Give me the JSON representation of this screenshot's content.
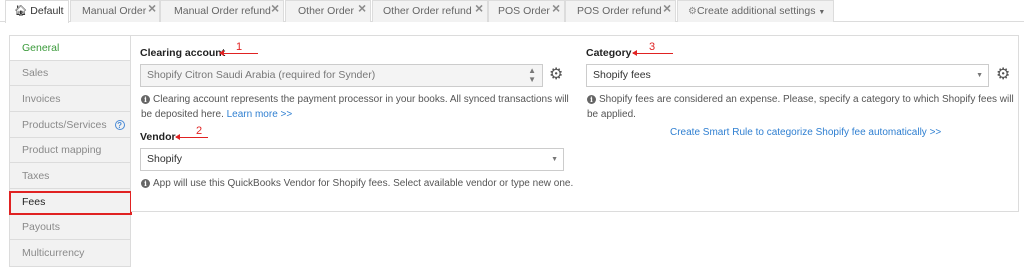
{
  "tabs": [
    {
      "label": "Default",
      "active": true,
      "icon": "home-icon",
      "closable": false
    },
    {
      "label": "Manual Order",
      "closable": true
    },
    {
      "label": "Manual Order refund",
      "closable": true
    },
    {
      "label": "Other Order",
      "closable": true
    },
    {
      "label": "Other Order refund",
      "closable": true
    },
    {
      "label": "POS Order",
      "closable": true
    },
    {
      "label": "POS Order refund",
      "closable": true
    },
    {
      "label": "Create additional settings",
      "icon": "gear-icon",
      "dropdown": true
    }
  ],
  "sidebar": {
    "items": [
      {
        "label": "General",
        "selected": true
      },
      {
        "label": "Sales"
      },
      {
        "label": "Invoices"
      },
      {
        "label": "Products/Services",
        "help_icon": true
      },
      {
        "label": "Product mapping"
      },
      {
        "label": "Taxes"
      },
      {
        "label": "Fees",
        "highlighted": true
      },
      {
        "label": "Payouts"
      },
      {
        "label": "Multicurrency"
      }
    ]
  },
  "clearing": {
    "label": "Clearing account",
    "marker": "1",
    "value": "Shopify Citron Saudi Arabia (required for Synder)",
    "help_text": "Clearing account represents the payment processor in your books. All synced transactions will be deposited here.",
    "learn_more": "Learn more >>"
  },
  "vendor": {
    "label": "Vendor",
    "marker": "2",
    "value": "Shopify",
    "help_text": "App will use this QuickBooks Vendor for Shopify fees. Select available vendor or type new one."
  },
  "category": {
    "label": "Category",
    "marker": "3",
    "value": "Shopify fees",
    "help_text": "Shopify fees are considered an expense. Please, specify a category to which Shopify fees will be applied.",
    "smart_rule_link": "Create Smart Rule to categorize Shopify fee automatically >>"
  },
  "colors": {
    "annotation": "#e02222",
    "link": "#2f7fd1",
    "selected_text": "#3a9a3a"
  }
}
